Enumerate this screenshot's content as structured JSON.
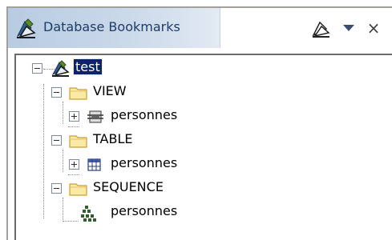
{
  "view": {
    "title": "Database Bookmarks",
    "close_label": "×"
  },
  "tree": {
    "root": {
      "label": "test",
      "expanded": true,
      "selected": true
    },
    "groups": [
      {
        "label": "VIEW",
        "expanded": true,
        "children": [
          {
            "label": "personnes",
            "type": "view",
            "expanded": false
          }
        ]
      },
      {
        "label": "TABLE",
        "expanded": true,
        "children": [
          {
            "label": "personnes",
            "type": "table",
            "expanded": false
          }
        ]
      },
      {
        "label": "SEQUENCE",
        "expanded": true,
        "children": [
          {
            "label": "personnes",
            "type": "sequence"
          }
        ]
      }
    ]
  },
  "colors": {
    "tab_gradient_start": "#b7cbe2",
    "tab_title": "#1d3c68",
    "selection_bg": "#0a246a",
    "folder_fill": "#fbe9a6",
    "folder_outline": "#c8a030",
    "sequence_icon": "#2e5e2a"
  },
  "icons": {
    "view_icon": "database-bookmark-icon",
    "bookmark_toolbar": "bookmark-icon",
    "menu": "chevron-down-icon",
    "close": "close-icon",
    "folder": "folder-icon",
    "view_node": "view-icon",
    "table_node": "table-icon",
    "sequence_node": "sequence-icon"
  }
}
